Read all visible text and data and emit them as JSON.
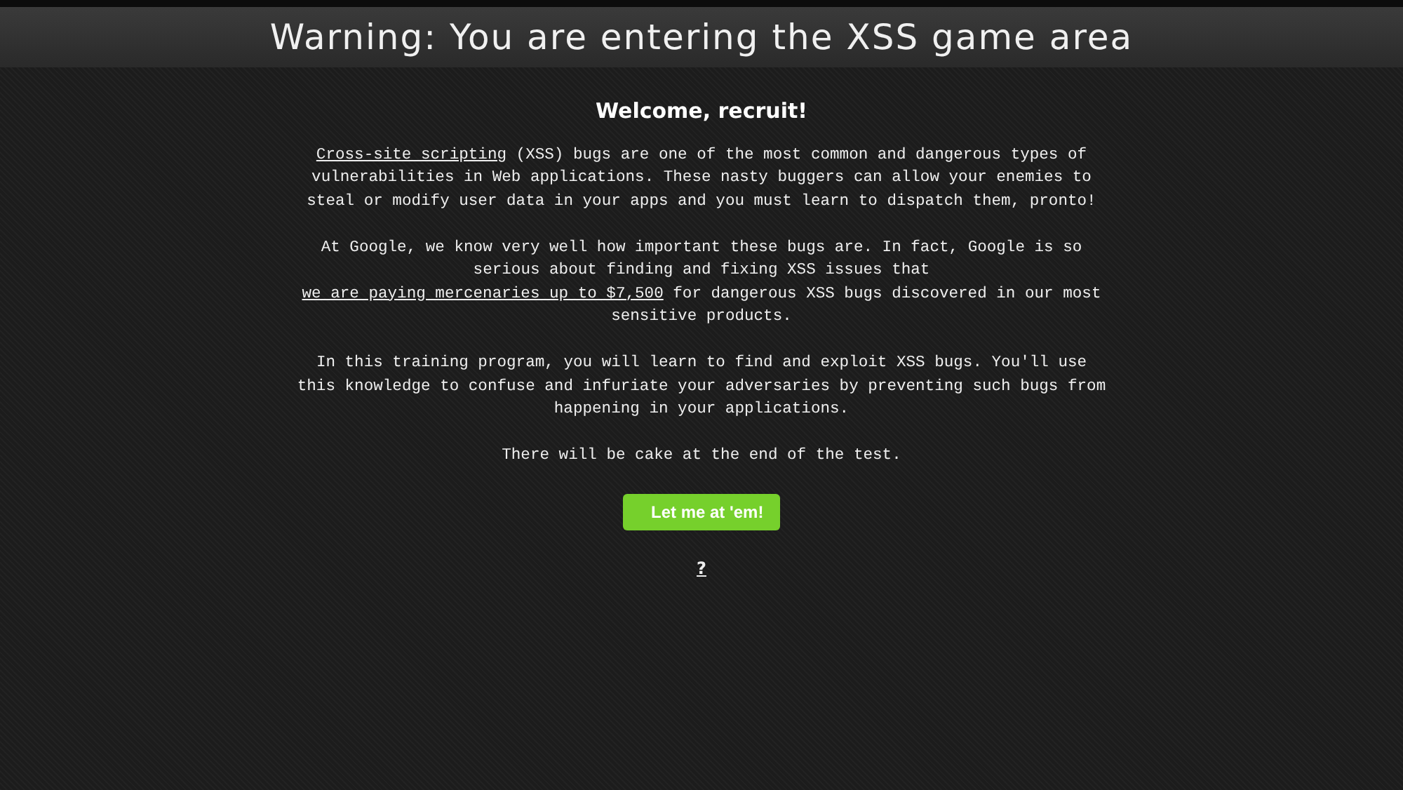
{
  "banner": {
    "title": "Warning: You are entering the XSS game area"
  },
  "heading": "Welcome, recruit!",
  "paragraphs": [
    [
      {
        "kind": "link",
        "text": "Cross-site scripting"
      },
      {
        "kind": "text",
        "text": " (XSS) bugs are one of the most common and dangerous types of vulnerabilities in Web applications. These nasty buggers can allow your enemies to steal or modify user data in your apps and you must learn to dispatch them, pronto!"
      }
    ],
    [
      {
        "kind": "text",
        "text": "At Google, we know very well how important these bugs are. In fact, Google is so serious about finding and fixing XSS issues that "
      },
      {
        "kind": "link",
        "text": "we are paying mercenaries up to $7,500"
      },
      {
        "kind": "text",
        "text": " for dangerous XSS bugs discovered in our most sensitive products."
      }
    ],
    [
      {
        "kind": "text",
        "text": "In this training program, you will learn to find and exploit XSS bugs. You'll use this knowledge to confuse and infuriate your adversaries by preventing such bugs from happening in your applications."
      }
    ],
    [
      {
        "kind": "text",
        "text": "There will be cake at the end of the test."
      }
    ]
  ],
  "button": "Let me at 'em!",
  "help_link": "?"
}
